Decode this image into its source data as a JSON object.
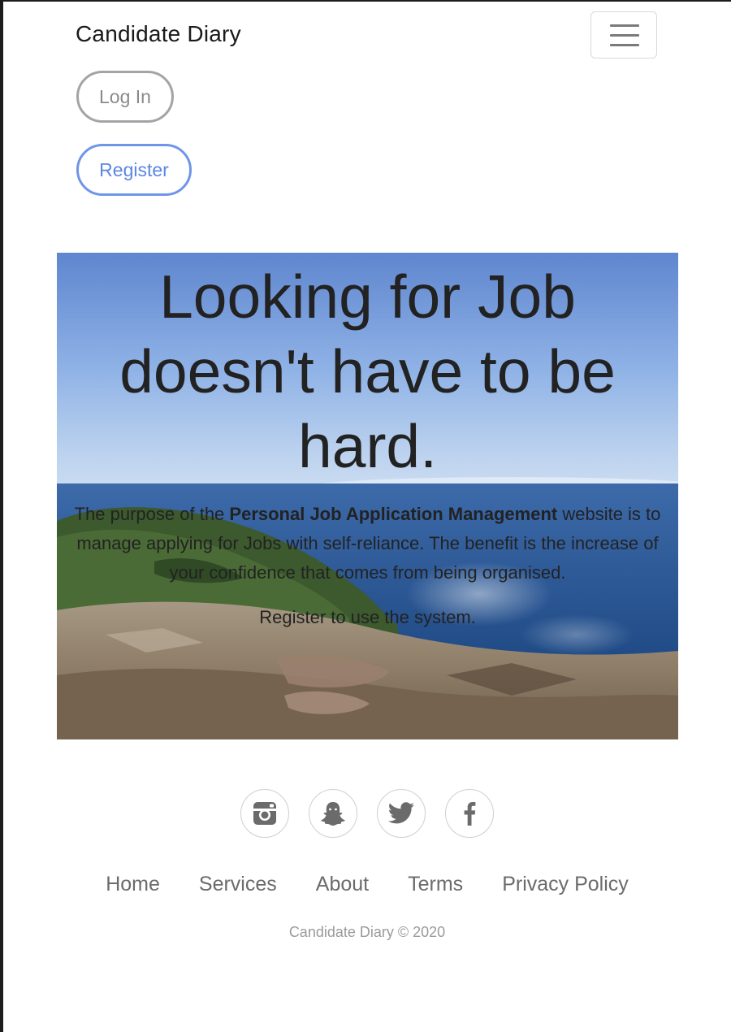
{
  "navbar": {
    "brand": "Candidate Diary",
    "toggler_icon": "hamburger-menu-icon"
  },
  "auth": {
    "login_label": "Log In",
    "register_label": "Register"
  },
  "hero": {
    "title": "Looking for Job doesn't have to be hard.",
    "lead_pre": "The purpose of the ",
    "lead_bold": "Personal Job Application Management",
    "lead_post": " website is to manage applying for Jobs with self-reliance. The benefit is the increase of your confidence that comes from being organised.",
    "cta": "Register to use the system."
  },
  "social": [
    {
      "icon": "instagram-icon"
    },
    {
      "icon": "snapchat-icon"
    },
    {
      "icon": "twitter-icon"
    },
    {
      "icon": "facebook-icon"
    }
  ],
  "footer": {
    "links": [
      "Home",
      "Services",
      "About",
      "Terms",
      "Privacy Policy"
    ],
    "copyright": "Candidate Diary © 2020"
  },
  "colors": {
    "primary_outline": "#6f95ea",
    "secondary_outline": "#a4a4a4",
    "footer_text": "#6b6b6b"
  }
}
